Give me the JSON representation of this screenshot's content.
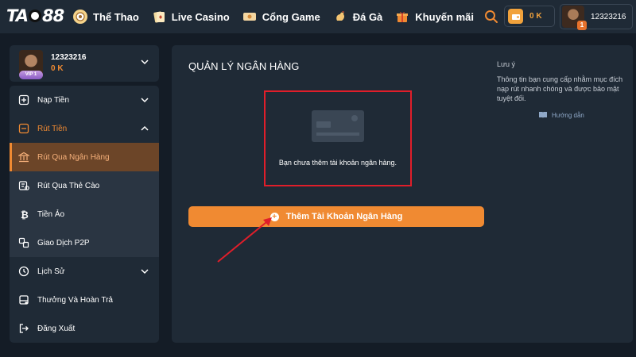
{
  "header": {
    "logo": {
      "text_before": "TA",
      "text_after": "88"
    },
    "nav": [
      {
        "label": "Thể Thao",
        "icon": "sports-icon",
        "color": "#f5d38a"
      },
      {
        "label": "Live Casino",
        "icon": "casino-card-icon",
        "color": "#f4dca0"
      },
      {
        "label": "Cổng Game",
        "icon": "game-ticket-icon",
        "color": "#f4d6a0"
      },
      {
        "label": "Đá Gà",
        "icon": "rooster-icon",
        "color": "#f3c472"
      },
      {
        "label": "Khuyến mãi",
        "icon": "gift-icon",
        "color": "#f08a32"
      }
    ],
    "wallet_balance": "0 K",
    "username": "12323216",
    "notification_count": "1"
  },
  "profile": {
    "username": "12323216",
    "balance": "0 K",
    "vip": "VIP 1"
  },
  "menu": {
    "items": [
      {
        "label": "Nạp Tiền",
        "icon": "deposit-icon"
      },
      {
        "label": "Rút Tiền",
        "icon": "withdraw-icon"
      },
      {
        "label": "Rút Qua Ngân Hàng",
        "icon": "bank-icon"
      },
      {
        "label": "Rút Qua Thẻ Cào",
        "icon": "scratch-card-icon"
      },
      {
        "label": "Tiền Ảo",
        "icon": "bitcoin-icon"
      },
      {
        "label": "Giao Dịch P2P",
        "icon": "p2p-icon"
      },
      {
        "label": "Lịch Sử",
        "icon": "history-icon"
      },
      {
        "label": "Thưởng Và Hoàn Trả",
        "icon": "rewards-icon"
      },
      {
        "label": "Đăng Xuất",
        "icon": "logout-icon"
      }
    ]
  },
  "main": {
    "title": "QUẢN LÝ NGÂN HÀNG",
    "empty_message": "Bạn chưa thêm tài khoản ngân hàng.",
    "add_button": "Thêm Tài Khoản Ngân Hàng",
    "note_title": "Lưu ý",
    "note_text": "Thông tin bạn cung cấp nhằm mục đích nạp rút nhanh chóng và được bảo mật tuyệt đối.",
    "guide_link": "Hướng dẫn"
  },
  "colors": {
    "accent": "#f08a32",
    "highlight_box": "#e01e2a",
    "annotation_arrow": "#e01e2a"
  }
}
